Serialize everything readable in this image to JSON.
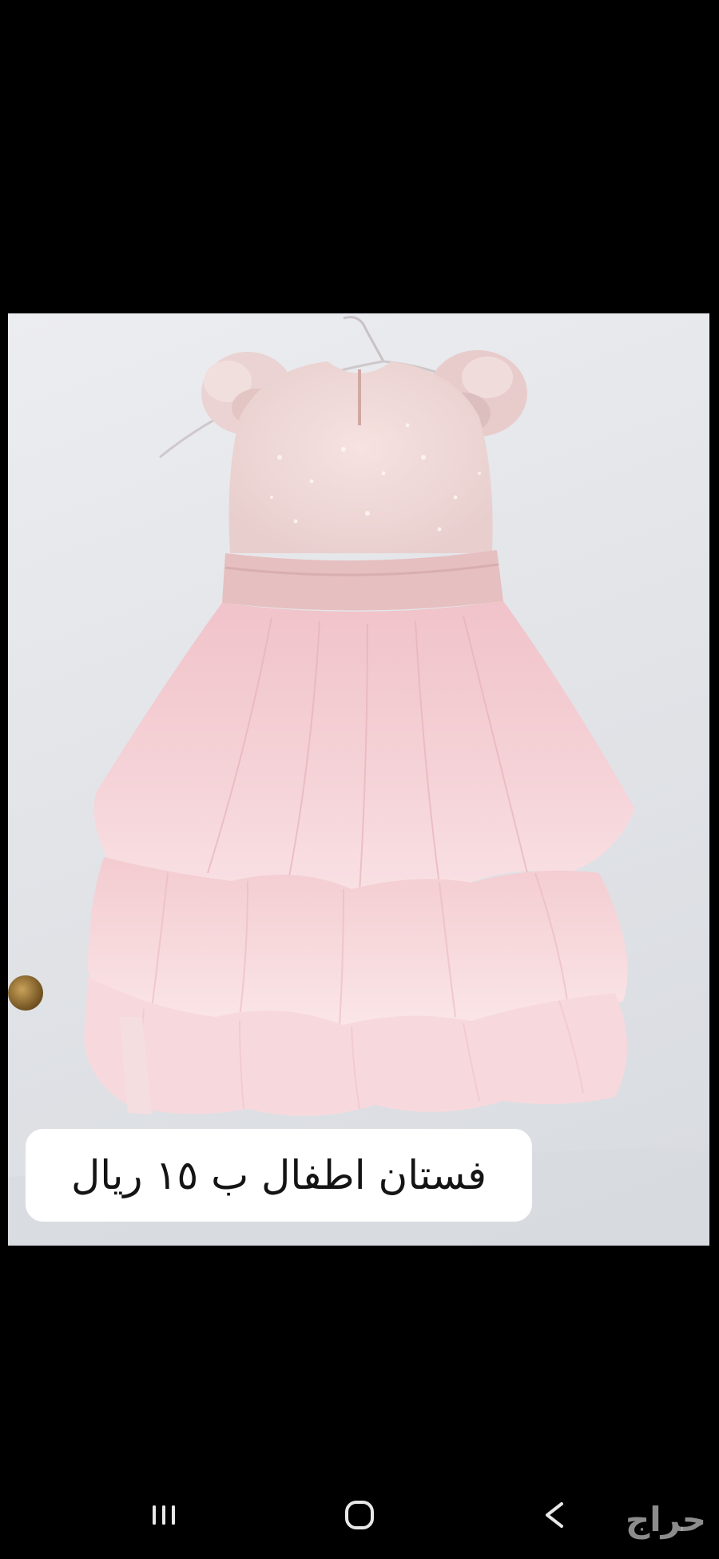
{
  "listing": {
    "caption": "فستان اطفال ب ١٥ ريال"
  },
  "watermark": {
    "text": "حراج"
  },
  "navbar": {
    "recents_icon": "recents-icon",
    "home_icon": "home-icon",
    "back_icon": "back-icon"
  },
  "colors": {
    "screen_background": "#000000",
    "photo_wall": "#e4e6ea",
    "dress_pink": "#f2c9cf",
    "caption_bubble": "#ffffff",
    "nav_icon": "#e8e8e8"
  }
}
